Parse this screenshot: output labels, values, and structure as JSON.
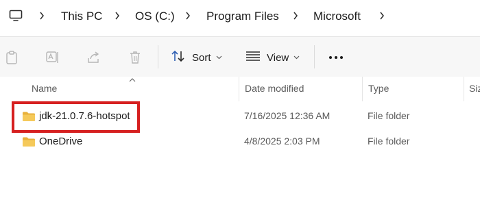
{
  "breadcrumb": {
    "items": [
      "This PC",
      "OS (C:)",
      "Program Files",
      "Microsoft"
    ]
  },
  "commandbar": {
    "sort_label": "Sort",
    "view_label": "View",
    "icons": [
      "paste-icon",
      "rename-icon",
      "share-icon",
      "delete-icon",
      "sort-icon",
      "view-icon",
      "more-icon"
    ]
  },
  "columns": {
    "name": "Name",
    "date_modified": "Date modified",
    "type": "Type",
    "size": "Size"
  },
  "files": [
    {
      "name": "jdk-21.0.7.6-hotspot",
      "date": "7/16/2025 12:36 AM",
      "type": "File folder",
      "highlighted": true
    },
    {
      "name": "OneDrive",
      "date": "4/8/2025 2:03 PM",
      "type": "File folder",
      "highlighted": false
    }
  ],
  "colors": {
    "folder": "#f2c14e",
    "highlight": "#d62020",
    "commandbar_bg": "#f7f7f7"
  }
}
